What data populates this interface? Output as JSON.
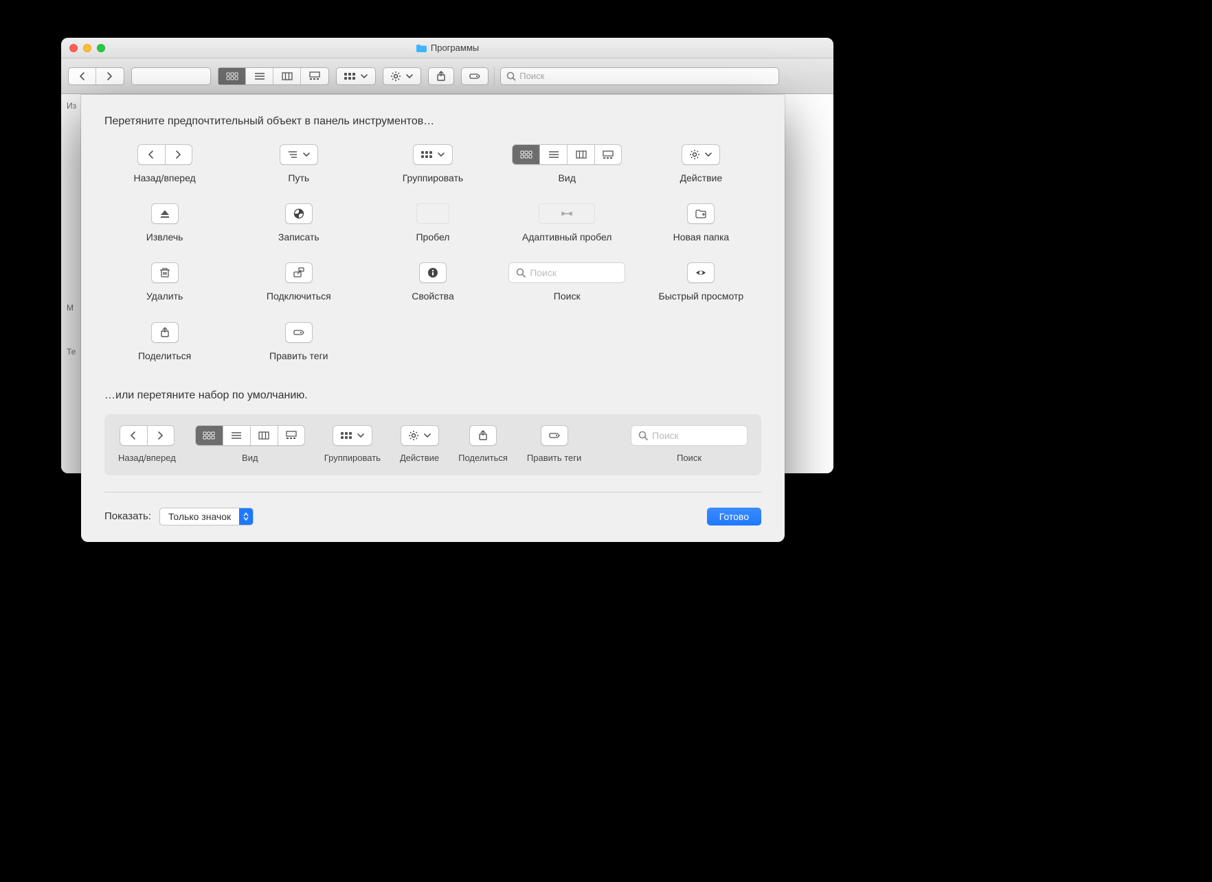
{
  "window": {
    "title": "Программы"
  },
  "toolbar": {
    "search_placeholder": "Поиск"
  },
  "sidebar": {
    "s1": "Из",
    "s2": "М",
    "s3": "Те"
  },
  "sheet": {
    "heading": "Перетяните предпочтительный объект в панель инструментов…",
    "default_heading": "…или перетяните набор по умолчанию.",
    "show_label": "Показать:",
    "show_value": "Только значок",
    "done": "Готово",
    "items": {
      "back_forward": "Назад/вперед",
      "path": "Путь",
      "group": "Группировать",
      "view": "Вид",
      "action": "Действие",
      "eject": "Извлечь",
      "burn": "Записать",
      "space": "Пробел",
      "flex_space": "Адаптивный пробел",
      "new_folder": "Новая папка",
      "delete": "Удалить",
      "connect": "Подключиться",
      "get_info": "Свойства",
      "search": "Поиск",
      "quick_look": "Быстрый просмотр",
      "share": "Поделиться",
      "tags": "Править теги"
    },
    "search_placeholder": "Поиск",
    "default_items": {
      "back_forward": "Назад/вперед",
      "view": "Вид",
      "group": "Группировать",
      "action": "Действие",
      "share": "Поделиться",
      "tags": "Править теги",
      "search": "Поиск"
    }
  }
}
